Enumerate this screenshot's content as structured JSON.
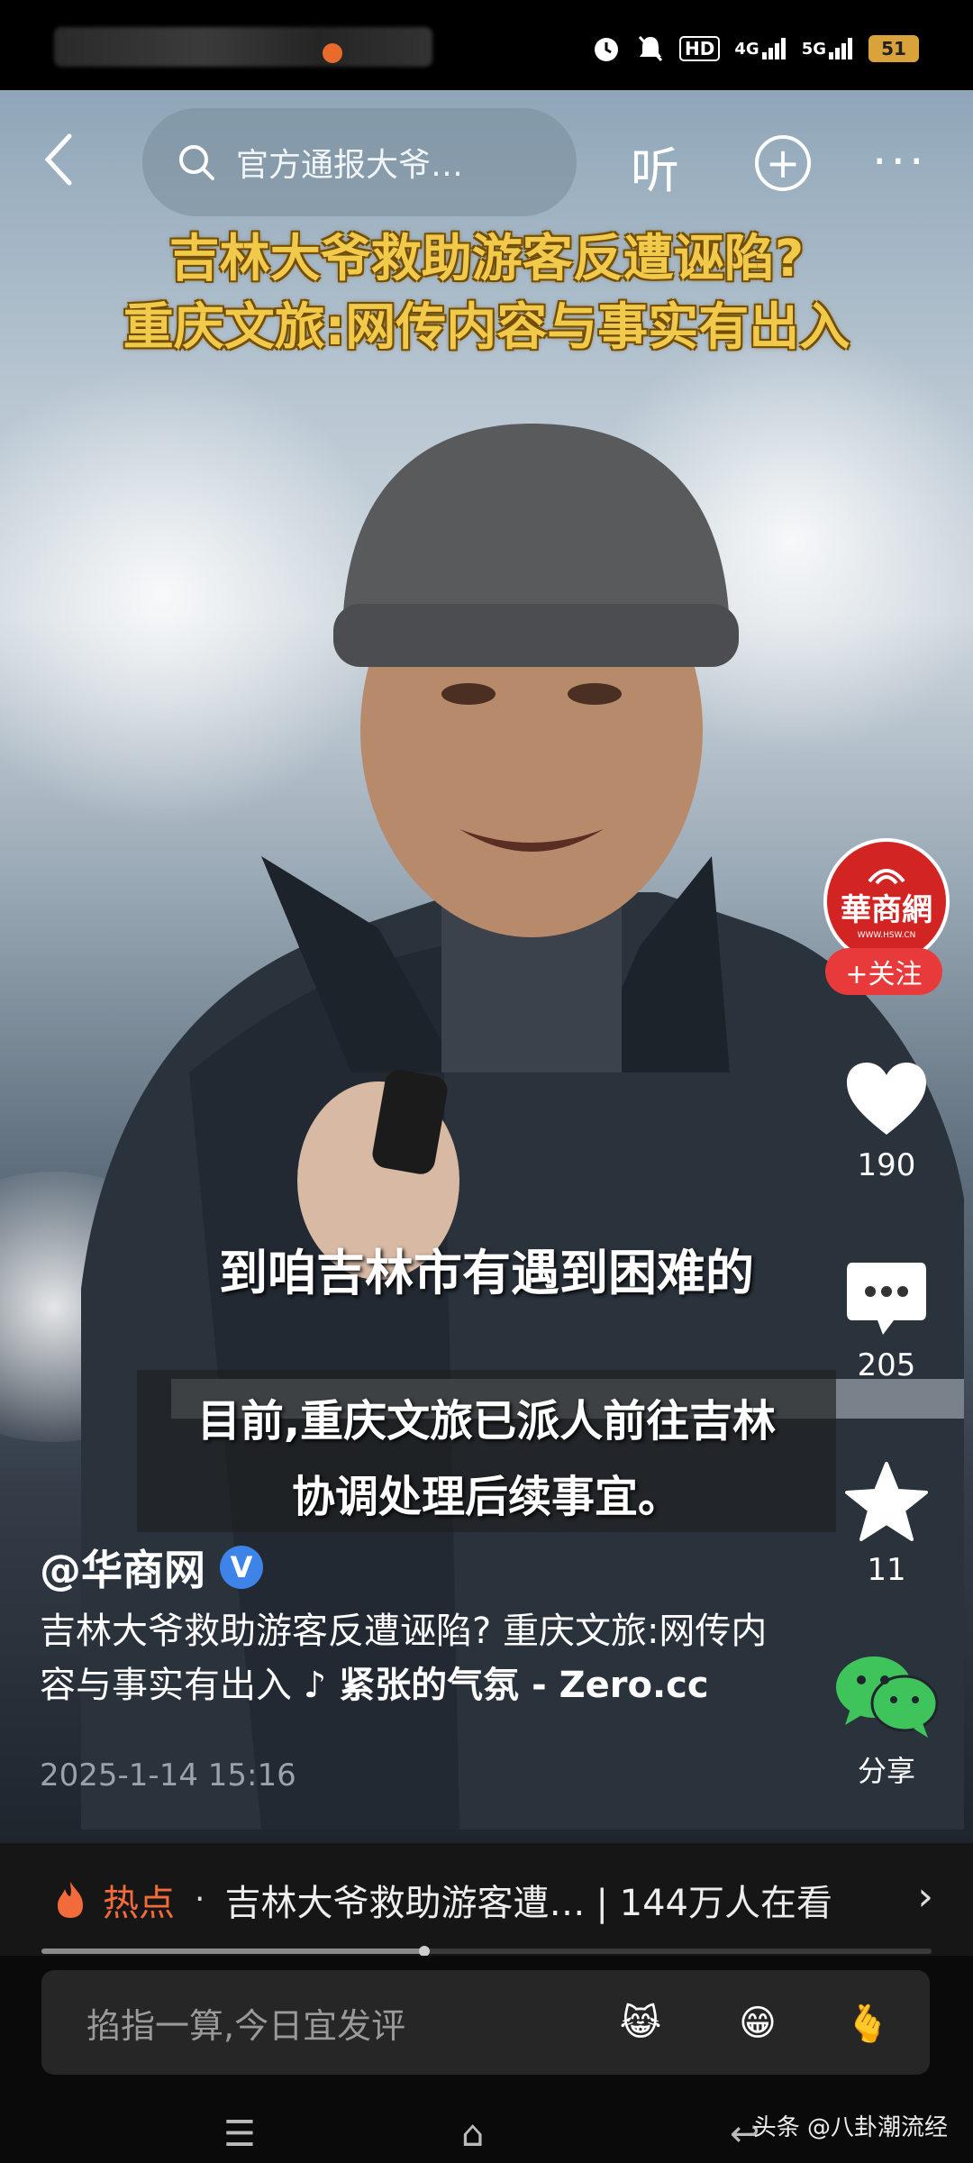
{
  "status_bar": {
    "icons": [
      "alarm-icon",
      "mute-icon",
      "hd-icon",
      "signal-4g-icon",
      "signal-5g-icon"
    ],
    "hd_label": "HD",
    "net1_label": "4G",
    "net2_label": "5G",
    "battery": "51"
  },
  "nav": {
    "search_text": "官方通报大爷…",
    "listen_label": "听"
  },
  "video": {
    "headline_line1": "吉林大爷救助游客反遭诬陷?",
    "headline_line2": "重庆文旅:网传内容与事实有出入",
    "subtitle": "到咱吉林市有遇到困难的",
    "caption_line1": "目前,重庆文旅已派人前往吉林",
    "caption_line2": "协调处理后续事宜。"
  },
  "side_actions": {
    "avatar_logo": "華商網",
    "avatar_sub": "WWW.HSW.CN",
    "follow_label": "+关注",
    "like_count": "190",
    "comment_count": "205",
    "favorite_count": "11",
    "share_label": "分享"
  },
  "post": {
    "author": "@华商网",
    "verified_mark": "V",
    "desc": "吉林大爷救助游客反遭诬陷? 重庆文旅:网传内容与事实有出入",
    "music": "♪ 紧张的气氛 - Zero.cc",
    "date": "2025-1-14 15:16"
  },
  "hotbar": {
    "label": "热点",
    "dot": "·",
    "text": "吉林大爷救助游客遭…",
    "count": "| 144万人在看"
  },
  "progress": 0.43,
  "comment_box": {
    "placeholder": "掐指一算,今日宜发评"
  },
  "emojis": [
    "😹",
    "😁",
    "🫰"
  ],
  "watermark": "头条 @八卦潮流经"
}
